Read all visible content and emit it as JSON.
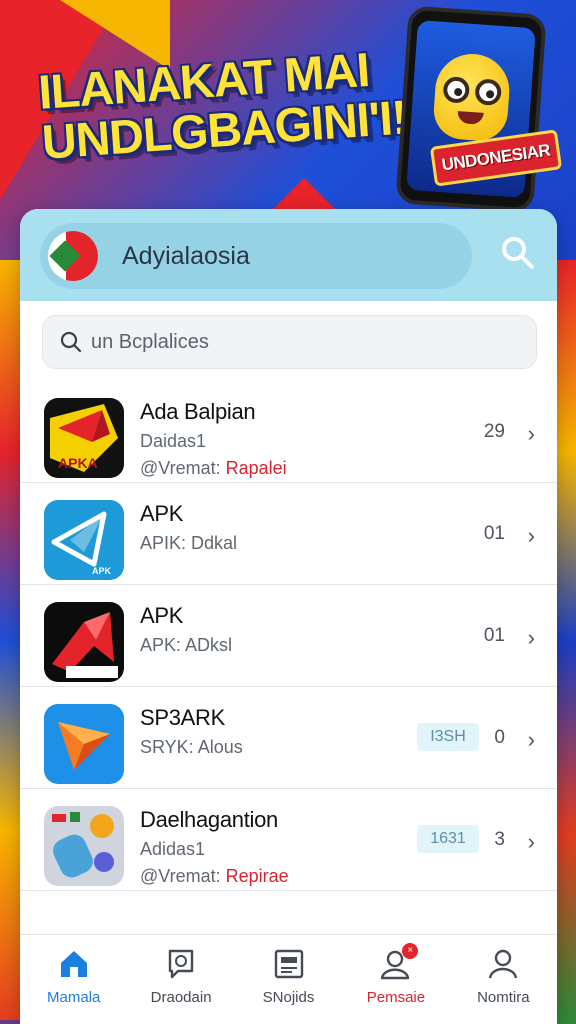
{
  "banner": {
    "headline_line1": "ILANAKAT MAI",
    "headline_line2": "UNDLGBAGINI'I!",
    "ribbon_text": "UNDONESIAR"
  },
  "header": {
    "site_name": "Adyialaosia",
    "search_icon": "search-icon"
  },
  "search": {
    "placeholder": "un Bcplalices"
  },
  "apps": [
    {
      "title": "Ada Balpian",
      "sub": "Daidas1",
      "sub2_prefix": "@Vremat:",
      "sub2_red": "Rapalei",
      "tag": "",
      "count": "29",
      "icon": "red-yellow-arrow-app-icon"
    },
    {
      "title": "APK",
      "sub": "APIK: Ddkal",
      "sub2_prefix": "",
      "sub2_red": "",
      "tag": "",
      "count": "01",
      "icon": "blue-paper-plane-app-icon"
    },
    {
      "title": "APK",
      "sub": "APK: ADksl",
      "sub2_prefix": "",
      "sub2_red": "",
      "tag": "",
      "count": "01",
      "icon": "red-black-arrow-app-icon"
    },
    {
      "title": "SP3ARK",
      "sub": "SRYK: Alous",
      "sub2_prefix": "",
      "sub2_red": "",
      "tag": "I3SH",
      "count": "0",
      "icon": "spark-triangle-app-icon"
    },
    {
      "title": "Daelhagantion",
      "sub": "Adidas1",
      "sub2_prefix": "@Vremat:",
      "sub2_red": "Repirae",
      "tag": "1631",
      "count": "3",
      "icon": "collage-app-icon"
    }
  ],
  "nav": [
    {
      "label": "Mamala",
      "icon": "home-icon",
      "state": "active"
    },
    {
      "label": "Draodain",
      "icon": "chat-icon",
      "state": ""
    },
    {
      "label": "SNojids",
      "icon": "news-icon",
      "state": ""
    },
    {
      "label": "Pemsaie",
      "icon": "person-alert-icon",
      "state": "alert"
    },
    {
      "label": "Nomtira",
      "icon": "profile-icon",
      "state": ""
    }
  ],
  "colors": {
    "accent_blue": "#1b7fe0",
    "alert_red": "#d9232d",
    "header_bg": "#a9e0ef",
    "headline_yellow": "#ffe23a"
  }
}
